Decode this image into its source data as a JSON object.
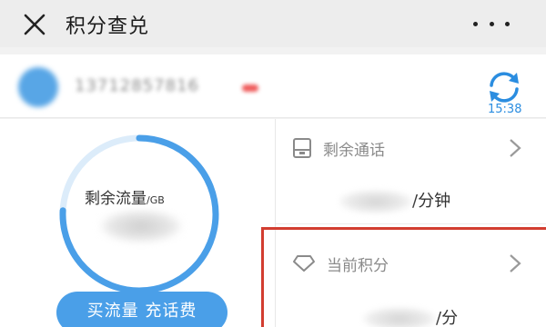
{
  "header": {
    "title": "积分查兑",
    "close_icon": "close-icon",
    "more_icon": "more-icon"
  },
  "user": {
    "phone": "13712857816",
    "refresh_time": "15:38",
    "refresh_icon": "refresh-icon"
  },
  "data_usage": {
    "label": "剩余流量",
    "unit": "/GB",
    "ring_color": "#4a9fe8",
    "ring_track_color": "#dcecfa"
  },
  "buy_button": {
    "label": "买流量 充话费"
  },
  "call_time": {
    "label": "剩余通话",
    "unit": "/分钟",
    "icon": "phone-card-icon"
  },
  "points": {
    "label": "当前积分",
    "unit": "/分",
    "icon": "diamond-icon",
    "highlight_color": "#d23d30"
  },
  "colors": {
    "accent": "#4a9fe8",
    "clock_text": "#2b8de0"
  }
}
